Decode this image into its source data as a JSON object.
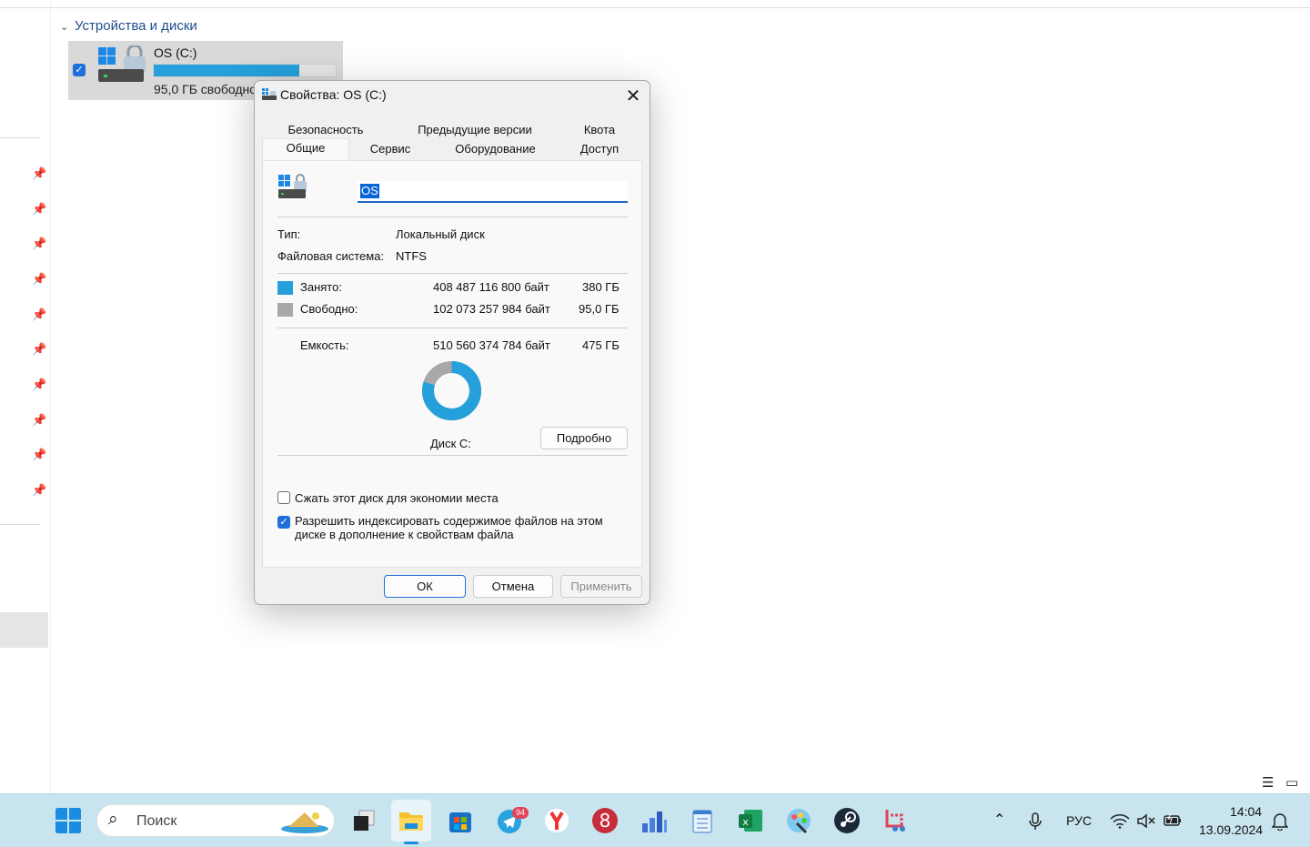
{
  "explorer": {
    "section_title": "Устройства и диски",
    "drive": {
      "name": "OS (C:)",
      "free_text": "95,0 ГБ свободно",
      "used_fraction": 0.8,
      "bar_color": "#26a0da"
    }
  },
  "dialog": {
    "title": "Свойства: OS (C:)",
    "tabs_row1": [
      "Безопасность",
      "Предыдущие версии",
      "Квота"
    ],
    "tabs_row2": [
      "Общие",
      "Сервис",
      "Оборудование",
      "Доступ"
    ],
    "active_tab": "Общие",
    "volume_label": "OS",
    "type_label": "Тип:",
    "type_value": "Локальный диск",
    "fs_label": "Файловая система:",
    "fs_value": "NTFS",
    "used_label": "Занято:",
    "used_bytes": "408 487 116 800 байт",
    "used_size": "380 ГБ",
    "used_color": "#26a0da",
    "free_label": "Свободно:",
    "free_bytes": "102 073 257 984 байт",
    "free_size": "95,0 ГБ",
    "free_color": "#a8a8a8",
    "capacity_label": "Емкость:",
    "capacity_bytes": "510 560 374 784 байт",
    "capacity_size": "475 ГБ",
    "disk_label": "Диск C:",
    "details_button": "Подробно",
    "compress_label": "Сжать этот диск для экономии места",
    "compress_checked": false,
    "index_label_line1": "Разрешить индексировать содержимое файлов на этом",
    "index_label_line2": "диске в дополнение к свойствам файла",
    "index_checked": true,
    "ok_button": "ОК",
    "cancel_button": "Отмена",
    "apply_button": "Применить"
  },
  "taskbar": {
    "search_placeholder": "Поиск",
    "telegram_badge": "94",
    "language": "РУС",
    "time": "14:04",
    "date": "13.09.2024",
    "apps": [
      "start-icon",
      "task-view-icon",
      "file-explorer-icon",
      "microsoft-store-icon",
      "telegram-icon",
      "yandex-browser-icon",
      "app-8-icon",
      "chart-app-icon",
      "notepad-icon",
      "excel-icon",
      "paint-icon",
      "steam-icon",
      "snipping-tool-icon"
    ]
  }
}
